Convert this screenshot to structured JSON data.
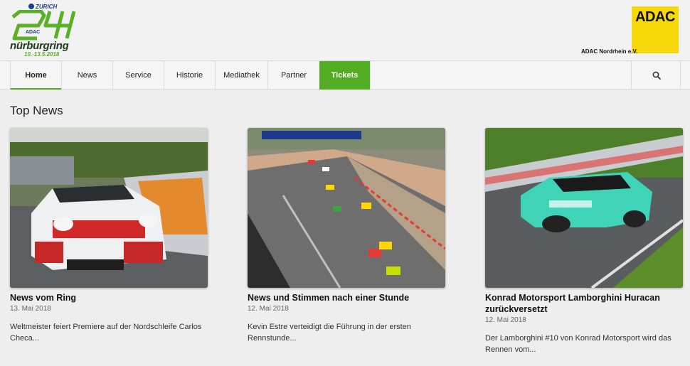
{
  "header": {
    "sponsor": "ZURICH",
    "event_name": "nürburgring",
    "event_dates": "10.-13.5.2018",
    "logo_small": "ADAC",
    "club_logo": "ADAC",
    "club_name": "ADAC Nordrhein e.V."
  },
  "nav": {
    "items": [
      {
        "label": "Home"
      },
      {
        "label": "News"
      },
      {
        "label": "Service"
      },
      {
        "label": "Historie"
      },
      {
        "label": "Mediathek"
      },
      {
        "label": "Partner"
      },
      {
        "label": "Tickets"
      }
    ],
    "search_icon": "search-icon"
  },
  "main": {
    "section_title": "Top News",
    "articles": [
      {
        "title": "News vom Ring",
        "date": "13. Mai 2018",
        "excerpt": "Weltmeister feiert Premiere auf der Nordschleife Carlos Checa..."
      },
      {
        "title": "News und Stimmen nach einer Stunde",
        "date": "12. Mai 2018",
        "excerpt": "Kevin Estre verteidigt die Führung in der ersten Rennstunde..."
      },
      {
        "title": "Konrad Motorsport Lamborghini Huracan zurückversetzt",
        "date": "12. Mai 2018",
        "excerpt": "Der Lamborghini #10 von Konrad Motorsport wird das Rennen vom..."
      }
    ]
  },
  "colors": {
    "brand_green": "#52ad22",
    "adac_yellow": "#f5d70a"
  }
}
